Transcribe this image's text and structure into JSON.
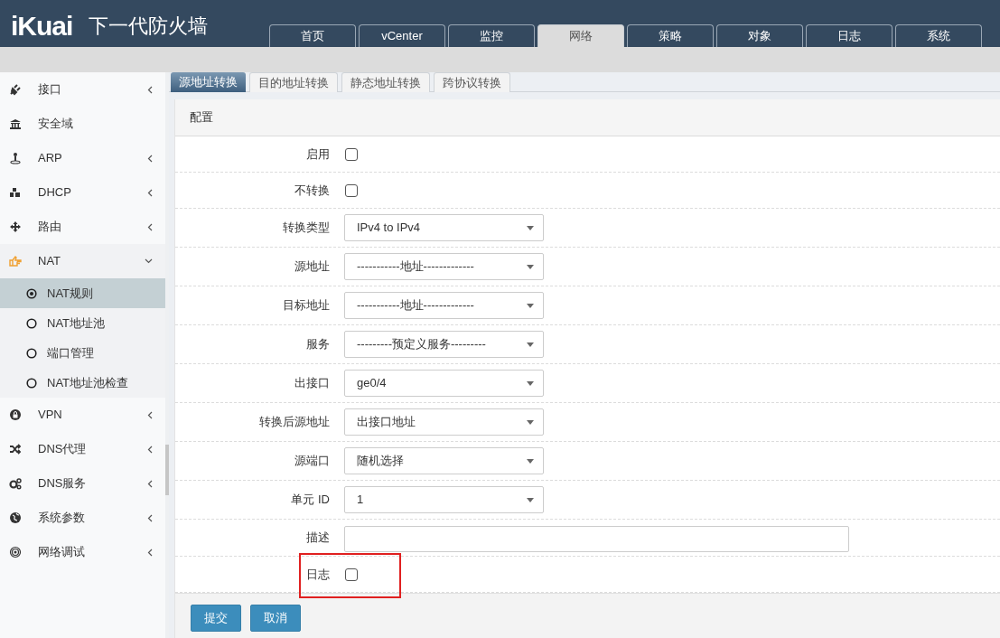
{
  "header": {
    "logo": "iKuai",
    "title": "下一代防火墙"
  },
  "nav_tabs": [
    {
      "label": "首页",
      "selected": false
    },
    {
      "label": "vCenter",
      "selected": false
    },
    {
      "label": "监控",
      "selected": false
    },
    {
      "label": "网络",
      "selected": true
    },
    {
      "label": "策略",
      "selected": false
    },
    {
      "label": "对象",
      "selected": false
    },
    {
      "label": "日志",
      "selected": false
    },
    {
      "label": "系统",
      "selected": false
    }
  ],
  "sidebar": {
    "items": [
      {
        "label": "接口",
        "has_submenu": true,
        "expanded": false
      },
      {
        "label": "安全域",
        "has_submenu": false
      },
      {
        "label": "ARP",
        "has_submenu": true,
        "expanded": false
      },
      {
        "label": "DHCP",
        "has_submenu": true,
        "expanded": false
      },
      {
        "label": "路由",
        "has_submenu": true,
        "expanded": false
      },
      {
        "label": "NAT",
        "has_submenu": true,
        "expanded": true,
        "children": [
          {
            "label": "NAT规则",
            "selected": true
          },
          {
            "label": "NAT地址池",
            "selected": false
          },
          {
            "label": "端口管理",
            "selected": false
          },
          {
            "label": "NAT地址池检查",
            "selected": false
          }
        ]
      },
      {
        "label": "VPN",
        "has_submenu": true,
        "expanded": false
      },
      {
        "label": "DNS代理",
        "has_submenu": true,
        "expanded": false
      },
      {
        "label": "DNS服务",
        "has_submenu": true,
        "expanded": false
      },
      {
        "label": "系统参数",
        "has_submenu": true,
        "expanded": false
      },
      {
        "label": "网络调试",
        "has_submenu": true,
        "expanded": false
      }
    ]
  },
  "sub_tabs": [
    {
      "label": "源地址转换",
      "selected": true
    },
    {
      "label": "目的地址转换",
      "selected": false
    },
    {
      "label": "静态地址转换",
      "selected": false
    },
    {
      "label": "跨协议转换",
      "selected": false
    }
  ],
  "panel": {
    "title": "配置",
    "rows": [
      {
        "kind": "checkbox",
        "label": "启用",
        "checked": false,
        "highlighted": false
      },
      {
        "kind": "checkbox",
        "label": "不转换",
        "checked": false,
        "highlighted": false
      },
      {
        "kind": "select",
        "label": "转换类型",
        "value": "IPv4 to IPv4",
        "highlighted": false
      },
      {
        "kind": "select",
        "label": "源地址",
        "value": "-----------地址-------------",
        "highlighted": false
      },
      {
        "kind": "select",
        "label": "目标地址",
        "value": "-----------地址-------------",
        "highlighted": false
      },
      {
        "kind": "select",
        "label": "服务",
        "value": "---------预定义服务---------",
        "highlighted": false
      },
      {
        "kind": "select",
        "label": "出接口",
        "value": "ge0/4",
        "highlighted": false
      },
      {
        "kind": "select",
        "label": "转换后源地址",
        "value": "出接口地址",
        "highlighted": false
      },
      {
        "kind": "select",
        "label": "源端口",
        "value": "随机选择",
        "highlighted": false
      },
      {
        "kind": "select",
        "label": "单元 ID",
        "value": "1",
        "highlighted": false
      },
      {
        "kind": "text",
        "label": "描述",
        "value": "",
        "highlighted": false
      },
      {
        "kind": "checkbox",
        "label": "日志",
        "checked": false,
        "highlighted": true
      }
    ],
    "buttons": [
      "提交",
      "取消"
    ]
  }
}
